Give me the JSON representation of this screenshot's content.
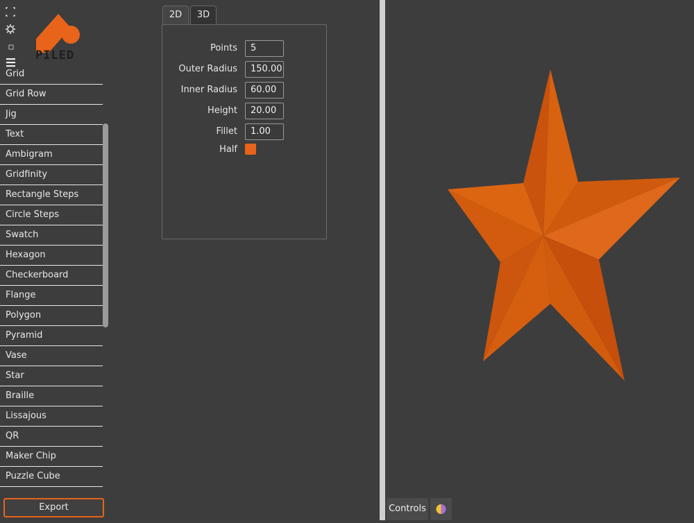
{
  "app": {
    "logo_text": "PILED",
    "accent_color": "#e8641a"
  },
  "toolbar_icons": [
    "fullscreen-icon",
    "settings-icon",
    "square-icon",
    "menu-icon"
  ],
  "sidebar": {
    "items": [
      {
        "label": "Grid"
      },
      {
        "label": "Grid Row"
      },
      {
        "label": "Jig"
      },
      {
        "label": "Text"
      },
      {
        "label": "Ambigram"
      },
      {
        "label": "Gridfinity"
      },
      {
        "label": "Rectangle Steps"
      },
      {
        "label": "Circle Steps"
      },
      {
        "label": "Swatch"
      },
      {
        "label": "Hexagon"
      },
      {
        "label": "Checkerboard"
      },
      {
        "label": "Flange"
      },
      {
        "label": "Polygon"
      },
      {
        "label": "Pyramid"
      },
      {
        "label": "Vase"
      },
      {
        "label": "Star"
      },
      {
        "label": "Braille"
      },
      {
        "label": "Lissajous"
      },
      {
        "label": "QR"
      },
      {
        "label": "Maker Chip"
      },
      {
        "label": "Puzzle Cube"
      }
    ],
    "export_label": "Export"
  },
  "tabs": [
    {
      "label": "2D"
    },
    {
      "label": "3D",
      "active": true
    }
  ],
  "form": {
    "points": {
      "label": "Points",
      "value": "5"
    },
    "outer_radius": {
      "label": "Outer Radius",
      "value": "150.00"
    },
    "inner_radius": {
      "label": "Inner Radius",
      "value": "60.00"
    },
    "height": {
      "label": "Height",
      "value": "20.00"
    },
    "fillet": {
      "label": "Fillet",
      "value": "1.00"
    },
    "half": {
      "label": "Half",
      "checked": true
    }
  },
  "viewport": {
    "controls_label": "Controls",
    "model_color": "#d4580f"
  }
}
